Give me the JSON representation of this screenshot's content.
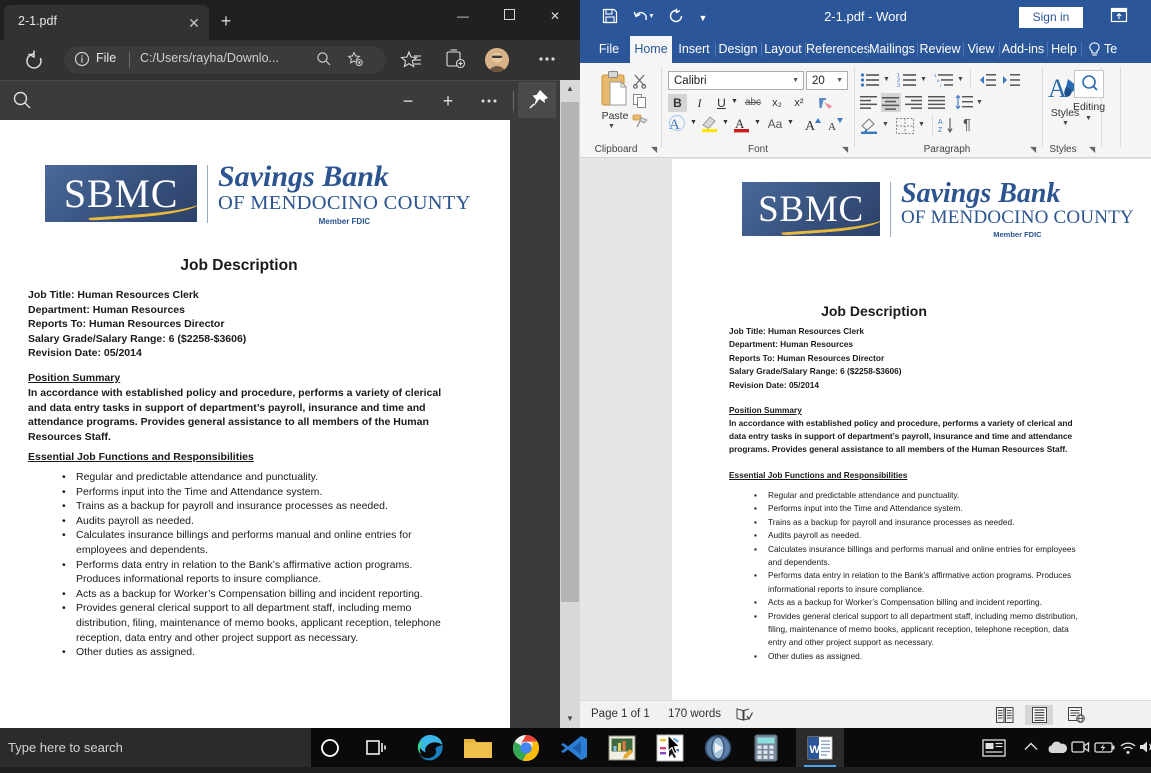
{
  "edge": {
    "tab": {
      "title": "2-1.pdf",
      "close_icon": "close-icon"
    },
    "new_tab_icon": "plus-icon",
    "window_controls": {
      "minimize": "—",
      "maximize": "☐",
      "close": "✕"
    },
    "nav": {
      "reload_icon": "reload-icon",
      "info_icon": "info-icon",
      "scheme_label": "File",
      "url": "C:/Users/rayha/Downlo...",
      "zoom_out_icon": "zoom-out-icon",
      "favorite_icon": "add-favorite-icon",
      "favorites_icon": "favorites-list-icon",
      "collections_icon": "collections-icon",
      "profile_icon": "profile-avatar",
      "more_icon": "more-options-icon"
    },
    "pdf_toolbar": {
      "search_icon": "search-icon",
      "zoom_out": "−",
      "zoom_in": "+",
      "more": "…",
      "pin_icon": "pin-icon"
    },
    "scrollbar": {
      "up": "▲",
      "down": "▼"
    }
  },
  "document": {
    "logo": {
      "mark": "SBMC",
      "line1": "Savings Bank",
      "line2": "OF MENDOCINO COUNTY",
      "line3": "Member FDIC"
    },
    "title": "Job Description",
    "meta": [
      "Job Title: Human Resources Clerk",
      "Department: Human Resources",
      "Reports To: Human Resources Director",
      "Salary Grade/Salary Range: 6 ($2258-$3606)",
      "Revision Date: 05/2014"
    ],
    "section1_heading": "Position Summary",
    "section1_body": "In accordance with established policy and procedure, performs a variety of clerical and data entry tasks in support of department’s payroll, insurance and time and attendance programs. Provides general assistance to all members of the Human Resources Staff.",
    "section2_heading": "Essential Job Functions and Responsibilities",
    "bullets": [
      "Regular and predictable attendance and punctuality.",
      "Performs input into the Time and Attendance system.",
      "Trains as a backup for payroll and insurance processes as needed.",
      "Audits payroll as needed.",
      "Calculates insurance billings and performs manual and online entries for employees and dependents.",
      "Performs data entry in relation to the Bank’s affirmative action programs. Produces informational reports to insure compliance.",
      "Acts as a backup for Worker’s Compensation billing and incident reporting.",
      "Provides general clerical support to all department staff, including memo distribution, filing, maintenance of memo books, applicant reception, telephone reception, data entry and other project support as necessary.",
      "Other duties as assigned."
    ]
  },
  "word": {
    "title": "2-1.pdf  -  Word",
    "sign_in": "Sign in",
    "qat": {
      "save_icon": "save-icon",
      "undo_icon": "undo-icon",
      "redo_icon": "redo-icon",
      "customize_icon": "customize-qat-icon"
    },
    "ribbon_display_icon": "ribbon-display-options-icon",
    "tabs": [
      "File",
      "Home",
      "Insert",
      "Design",
      "Layout",
      "References",
      "Mailings",
      "Review",
      "View",
      "Add-ins",
      "Help"
    ],
    "tellme": "Te",
    "tellme_icon": "lightbulb-icon",
    "active_tab": "Home",
    "groups": {
      "clipboard": {
        "label": "Clipboard",
        "paste": "Paste",
        "paste_icon": "paste-icon",
        "cut_icon": "cut-scissors-icon",
        "copy_icon": "copy-icon",
        "format_painter_icon": "format-painter-icon",
        "dialog_icon": "dialog-launcher-icon"
      },
      "font": {
        "label": "Font",
        "font_name": "Calibri",
        "font_size": "20",
        "bold": "B",
        "italic": "I",
        "underline": "U",
        "strikethrough": "abc",
        "subscript": "x₂",
        "superscript": "x²",
        "clear_formatting_icon": "clear-formatting-icon",
        "text_effects_icon": "text-effects-icon",
        "highlight_icon": "text-highlight-icon",
        "font_color_icon": "font-color-icon",
        "change_case": "Aa",
        "grow_font_icon": "grow-font-icon",
        "shrink_font_icon": "shrink-font-icon",
        "dialog_icon": "dialog-launcher-icon"
      },
      "paragraph": {
        "label": "Paragraph",
        "bullets_icon": "bullet-list-icon",
        "numbering_icon": "numbered-list-icon",
        "multilevel_icon": "multilevel-list-icon",
        "decrease_indent_icon": "decrease-indent-icon",
        "increase_indent_icon": "increase-indent-icon",
        "align_left_icon": "align-left-icon",
        "align_center_icon": "align-center-icon",
        "align_right_icon": "align-right-icon",
        "justify_icon": "justify-icon",
        "line_spacing_icon": "line-spacing-icon",
        "shading_icon": "shading-icon",
        "borders_icon": "borders-icon",
        "sort_icon": "sort-icon",
        "show_marks_icon": "show-formatting-marks-icon",
        "dialog_icon": "dialog-launcher-icon"
      },
      "styles": {
        "label": "Styles",
        "button": "Styles",
        "icon": "styles-icon",
        "dialog_icon": "dialog-launcher-icon"
      },
      "editing": {
        "label": "Editing",
        "button": "Editing",
        "icon": "find-magnifier-icon"
      }
    },
    "status": {
      "page": "Page 1 of 1",
      "words": "170 words",
      "proofing_icon": "proofing-errors-icon",
      "read_mode_icon": "read-mode-icon",
      "print_layout_icon": "print-layout-icon",
      "web_layout_icon": "web-layout-icon",
      "zoom_minus": "−"
    }
  },
  "taskbar": {
    "search_placeholder": "Type here to search",
    "cortana_icon": "cortana-circle-icon",
    "task_view_icon": "task-view-icon",
    "apps": [
      {
        "name": "edge-icon",
        "active": false
      },
      {
        "name": "file-explorer-icon",
        "active": false
      },
      {
        "name": "chrome-icon",
        "active": false
      },
      {
        "name": "vscode-icon",
        "active": false
      },
      {
        "name": "image-editor-icon",
        "active": false
      },
      {
        "name": "paint-tool-icon",
        "active": false
      },
      {
        "name": "media-player-icon",
        "active": false
      },
      {
        "name": "calculator-icon",
        "active": false
      },
      {
        "name": "word-icon",
        "active": true
      }
    ],
    "tray": [
      "news-and-interests-icon",
      "show-hidden-icons-icon",
      "onedrive-icon",
      "camera-icon",
      "battery-icon",
      "wifi-icon",
      "volume-icon"
    ]
  },
  "colors": {
    "word_blue": "#2b579a",
    "edge_dark": "#323232",
    "logo_blue": "#2b5490",
    "logo_gold": "#e8b93c",
    "taskbar": "#0a0a0a"
  }
}
